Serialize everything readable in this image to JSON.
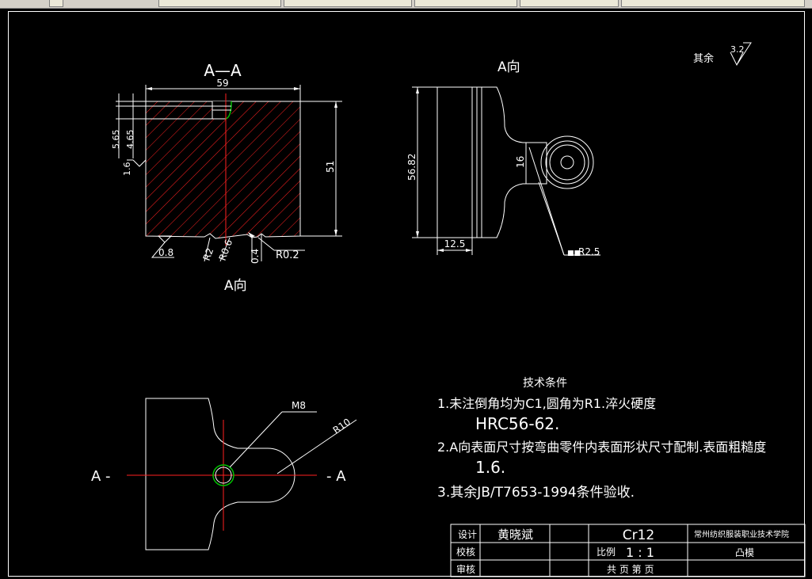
{
  "toolbar": {
    "tabs": [
      "",
      "",
      "",
      "",
      ""
    ]
  },
  "view_aa": {
    "title": "A—A",
    "dim_width": "59",
    "dim_565": "5.65",
    "dim_465": "4.65",
    "dim_16": "1.6",
    "dim_51": "51",
    "rough_08": "0.8",
    "dim_r2": "R2",
    "dim_r06": "R0.6",
    "dim_04": "0.4",
    "dim_r02": "R0.2",
    "view_label": "A向"
  },
  "view_a": {
    "title": "A向",
    "dim_5682": "56.82",
    "dim_16": "16",
    "dim_125": "12.5",
    "dim_r25": "R2.5",
    "leader_prefix": "■■"
  },
  "roughness": {
    "label": "其余",
    "value": "3.2"
  },
  "plan_view": {
    "m8": "M8",
    "r10": "R10",
    "section_left": "A -",
    "section_right": "- A"
  },
  "tech": {
    "title": "技术条件",
    "l1a": "1.未注倒角均为C1,圆角为R1.淬火硬度",
    "l1b": "HRC56-62.",
    "l2a": "2.A向表面尺寸按弯曲零件内表面形状尺寸配制.表面粗糙度",
    "l2b": "1.6.",
    "l3": "3.其余JB/T7653-1994条件验收."
  },
  "title_block": {
    "design_label": "设计",
    "designer": "黄晓斌",
    "check_label": "校核",
    "review_label": "审核",
    "material": "Cr12",
    "scale_label": "比例",
    "scale_value": "1 : 1",
    "sheets": "共 页 第 页",
    "school": "常州纺织服装职业技术学院",
    "part_name": "凸模"
  }
}
